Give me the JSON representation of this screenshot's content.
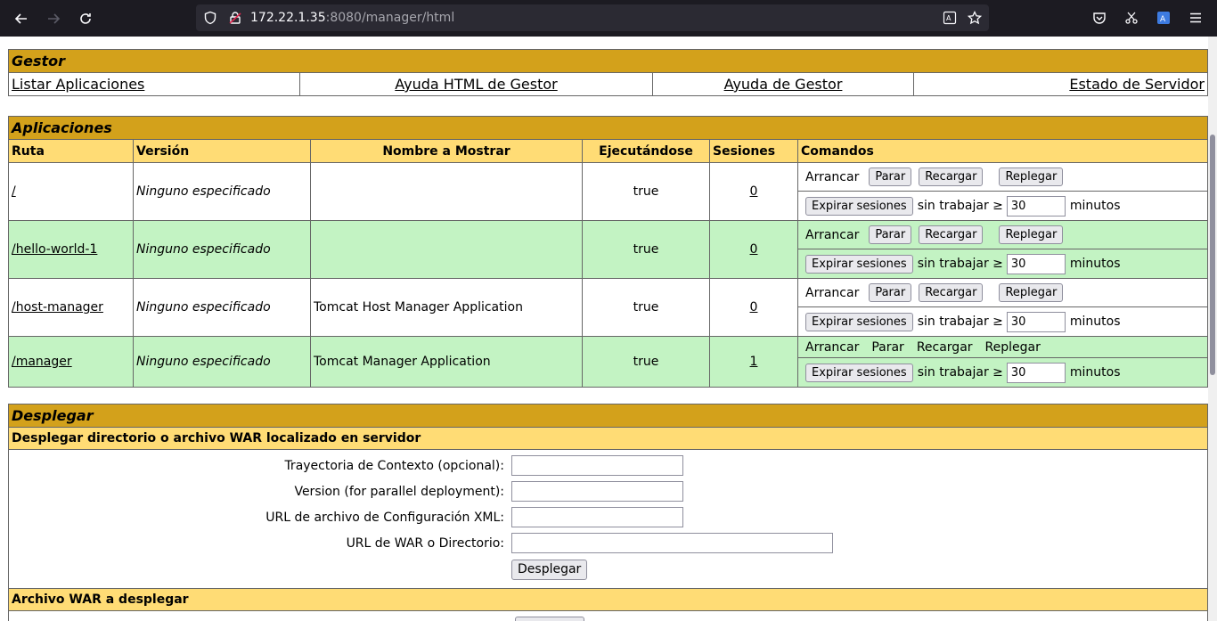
{
  "browser": {
    "url_host": "172.22.1.35",
    "url_rest": ":8080/manager/html"
  },
  "gestor": {
    "title": "Gestor",
    "links": [
      "Listar Aplicaciones",
      "Ayuda HTML de Gestor",
      "Ayuda de Gestor",
      "Estado de Servidor"
    ]
  },
  "apps": {
    "title": "Aplicaciones",
    "headers": [
      "Ruta",
      "Versión",
      "Nombre a Mostrar",
      "Ejecutándose",
      "Sesiones",
      "Comandos"
    ],
    "rows": [
      {
        "path": "/",
        "version": "Ninguno especificado",
        "display": "",
        "running": "true",
        "sessions": "0"
      },
      {
        "path": "/hello-world-1",
        "version": "Ninguno especificado",
        "display": "",
        "running": "true",
        "sessions": "0"
      },
      {
        "path": "/host-manager",
        "version": "Ninguno especificado",
        "display": "Tomcat Host Manager Application",
        "running": "true",
        "sessions": "0"
      },
      {
        "path": "/manager",
        "version": "Ninguno especificado",
        "display": "Tomcat Manager Application",
        "running": "true",
        "sessions": "1"
      }
    ],
    "commands": {
      "start": "Arrancar",
      "stop": "Parar",
      "reload": "Recargar",
      "undeploy": "Replegar",
      "expire": "Expirar sesiones",
      "idle": "sin trabajar ≥",
      "minutes_value": "30",
      "minutes": "minutos"
    }
  },
  "deploy": {
    "title": "Desplegar",
    "section1": "Desplegar directorio o archivo WAR localizado en servidor",
    "fields": [
      "Trayectoria de Contexto (opcional):",
      "Version (for parallel deployment):",
      "URL de archivo de Configuración XML:",
      "URL de WAR o Directorio:"
    ],
    "button": "Desplegar",
    "section2": "Archivo WAR a desplegar"
  }
}
